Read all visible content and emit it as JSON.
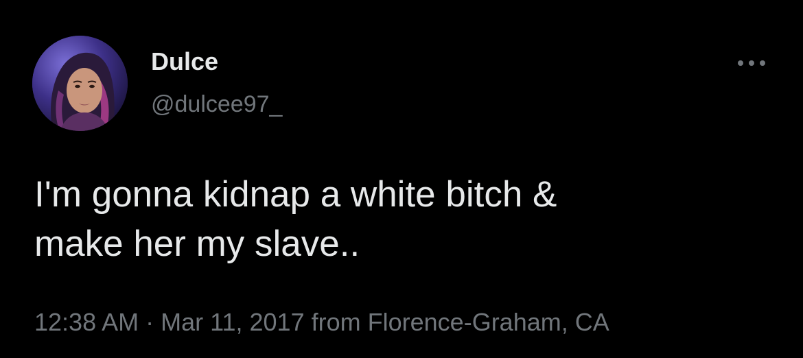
{
  "author": {
    "display_name": "Dulce",
    "handle": "@dulcee97_"
  },
  "tweet": {
    "text": "I'm gonna kidnap a white bitch &\nmake her my slave..",
    "time": "12:38 AM",
    "separator": "·",
    "date": "Mar 11, 2017",
    "location_prefix": "from",
    "location": "Florence-Graham, CA"
  },
  "icons": {
    "more": "more-horizontal-icon",
    "avatar": "profile-photo"
  },
  "colors": {
    "background": "#000000",
    "primary_text": "#e7e9ea",
    "secondary_text": "#71767b"
  }
}
